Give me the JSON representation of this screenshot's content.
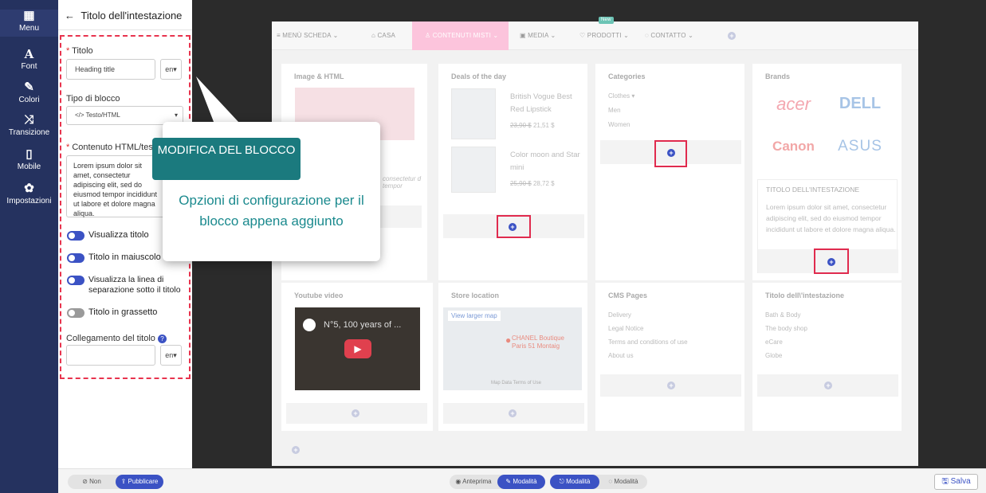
{
  "nav": {
    "items": [
      {
        "label": "Menu",
        "icon": "grid-icon"
      },
      {
        "label": "Font",
        "icon": "font-icon"
      },
      {
        "label": "Colori",
        "icon": "brush-icon"
      },
      {
        "label": "Transizione",
        "icon": "shuffle-icon"
      },
      {
        "label": "Mobile",
        "icon": "mobile-icon"
      },
      {
        "label": "Impostazioni",
        "icon": "gear-icon"
      }
    ]
  },
  "panel": {
    "title": "Titolo dell'intestazione",
    "titolo_label": "Titolo",
    "titolo_value": "Heading title",
    "lang": "en",
    "tipo_label": "Tipo di blocco",
    "tipo_value": "</> Testo/HTML",
    "contenuto_label": "Contenuto HTML/testo",
    "contenuto_value": "Lorem ipsum dolor sit amet, consectetur adipiscing elit, sed do eiusmod tempor incididunt ut labore et dolore magna aliqua.",
    "toggles": [
      {
        "label": "Visualizza titolo",
        "on": true
      },
      {
        "label": "Titolo in maiuscolo",
        "on": true
      },
      {
        "label": "Visualizza la linea di separazione sotto il titolo",
        "on": true
      },
      {
        "label": "Titolo in grassetto",
        "on": false
      }
    ],
    "link_label": "Collegamento del titolo",
    "link_lang": "en"
  },
  "callout": {
    "title": "MODIFICA DEL BLOCCO",
    "desc": "Opzioni di configurazione per il blocco appena aggiunto"
  },
  "preview": {
    "menu": [
      {
        "label": "≡ MENÙ SCHEDA ⌄"
      },
      {
        "label": "⌂ CASA"
      },
      {
        "label": "♙ CONTENUTI MISTI ⌄"
      },
      {
        "label": "▣ MEDIA ⌄"
      },
      {
        "label": "♡ PRODOTTI ⌄"
      },
      {
        "label": "◌ CONTATTO ⌄"
      }
    ],
    "new_badge": "New",
    "row1": {
      "image_html": {
        "title": "Image & HTML",
        "text": "consectetur d tempor"
      },
      "deals": {
        "title": "Deals of the day",
        "products": [
          {
            "name": "British Vogue Best Red Lipstick",
            "old": "23,90 $",
            "new": "21,51 $"
          },
          {
            "name": "Color moon and Star mini",
            "old": "25,90 $",
            "new": "28,72 $"
          }
        ]
      },
      "categories": {
        "title": "Categories",
        "items": [
          "Clothes ▾",
          "Men",
          "Women"
        ]
      },
      "brands": {
        "title": "Brands",
        "logos": [
          "acer",
          "DELL",
          "Canon",
          "ASUS"
        ]
      },
      "heading_block": {
        "title": "TITOLO DELL'INTESTAZIONE",
        "text": "Lorem ipsum dolor sit amet, consectetur adipiscing elit, sed do eiusmod tempor incididunt ut labore et dolore magna aliqua."
      }
    },
    "row2": {
      "youtube": {
        "title": "Youtube video",
        "video_title": "N°5, 100 years of ..."
      },
      "store": {
        "title": "Store location",
        "map_link": "View larger map",
        "map_text": "CHANEL Boutique Paris 51 Montaig",
        "map_footer": "Map Data  Terms of Use"
      },
      "cms": {
        "title": "CMS Pages",
        "items": [
          "Delivery",
          "Legal Notice",
          "Terms and conditions of use",
          "About us"
        ]
      },
      "heading2": {
        "title": "Titolo dell\\'intestazione",
        "items": [
          "Bath & Body",
          "The body shop",
          "eCare",
          "Globe"
        ]
      }
    }
  },
  "bottom": {
    "non": "⊘ Non",
    "pubblicare": "⇪ Pubblicare",
    "anteprima": "◉ Anteprima",
    "modalita1": "✎ Modalità",
    "modalita2": "⎋ Modalità",
    "modalita3": "◌ Modalità",
    "save": "Salva"
  }
}
